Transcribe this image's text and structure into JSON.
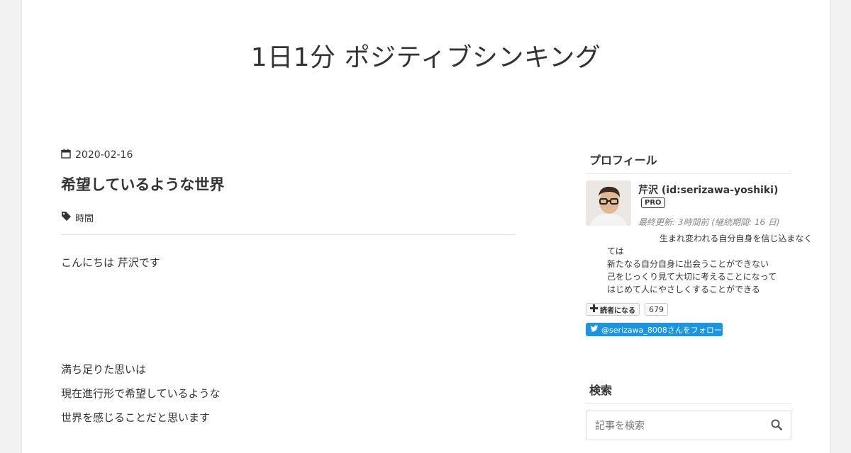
{
  "blog": {
    "title": "1日1分 ポジティブシンキング"
  },
  "entry": {
    "date": "2020-02-16",
    "title": "希望しているような世界",
    "category": "時間",
    "paragraphs": [
      "こんにちは 芹沢です",
      "満ち足りた思いは",
      "現在進行形で希望しているような",
      "世界を感じることだと思います"
    ]
  },
  "sidebar": {
    "profile": {
      "heading": "プロフィール",
      "name": "芹沢 (id:serizawa-yoshiki)",
      "badge": "PRO",
      "updated": "最終更新: 3時間前 (継続期間: 16 日)",
      "description": [
        "生まれ変われる自分自身を信じ込まなく",
        "ては",
        "新たなる自分自身に出会うことができない",
        "己をじっくり見て大切に考えることになって",
        "はじめて人にやさしくすることができる"
      ],
      "reader_button": "読者になる",
      "reader_count": "679",
      "twitter_follow": "@serizawa_8008さんをフォロー"
    },
    "search": {
      "heading": "検索",
      "placeholder": "記事を検索"
    }
  },
  "colors": {
    "twitter": "#1b95e0",
    "text": "#333333",
    "muted": "#888888"
  },
  "icons": [
    "calendar-icon",
    "tag-icon",
    "plus-icon",
    "twitter-bird-icon",
    "search-icon"
  ]
}
